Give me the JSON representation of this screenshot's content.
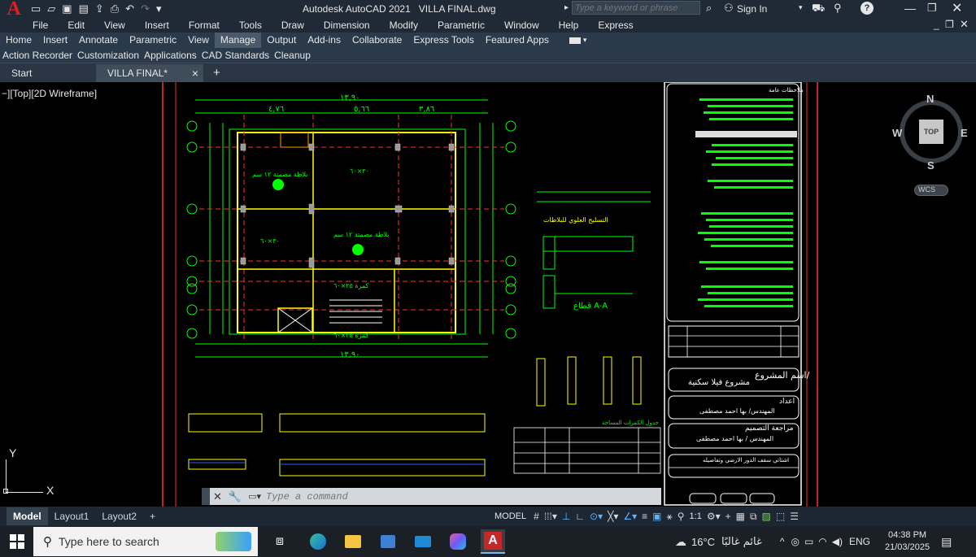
{
  "app": {
    "title": "Autodesk AutoCAD 2021",
    "filename": "VILLA FINAL.dwg",
    "search_placeholder": "Type a keyword or phrase",
    "sign_in": "Sign In",
    "logo_letter": "A",
    "quick_access_icons": [
      "new-icon",
      "open-icon",
      "save-icon",
      "saveas-icon",
      "web-mobile-icon",
      "print-icon",
      "undo-icon",
      "redo-icon",
      "dropdown-icon"
    ]
  },
  "menubar": [
    "File",
    "Edit",
    "View",
    "Insert",
    "Format",
    "Tools",
    "Draw",
    "Dimension",
    "Modify",
    "Parametric",
    "Window",
    "Help",
    "Express"
  ],
  "ribbon": {
    "tabs": [
      "Home",
      "Insert",
      "Annotate",
      "Parametric",
      "View",
      "Manage",
      "Output",
      "Add-ins",
      "Collaborate",
      "Express Tools",
      "Featured Apps"
    ],
    "active_tab": "Manage",
    "panels": [
      "Action Recorder",
      "Customization",
      "Applications",
      "CAD Standards",
      "Cleanup"
    ]
  },
  "file_tabs": {
    "start": "Start",
    "active": "VILLA FINAL*",
    "close": "×",
    "add": "+"
  },
  "viewport": {
    "label": "−][Top][2D Wireframe]",
    "compass": {
      "n": "N",
      "s": "S",
      "e": "E",
      "w": "W",
      "top": "TOP",
      "wcs": "WCS"
    },
    "ucs": {
      "x": "X",
      "y": "Y"
    },
    "command_placeholder": "Type a command",
    "drawing": {
      "top_dims": [
        "٤,٧٦",
        "٥,٦٦",
        "٣,٨٦"
      ],
      "top_total": "١٣,٩٠",
      "grid_labels_left": [
        "①",
        "②",
        "③",
        "④",
        "⑤",
        "⑥",
        "⑦",
        "⑧"
      ],
      "section_title": "قطاع A-A",
      "project_title_label": "اسم المشروع/",
      "project_name": "مشروع فيلا سكنية",
      "prepared_label": "اعداد",
      "engineer": "المهندس/ بها احمد مصطفى",
      "review_label": "مراجعة التصميم",
      "reviewer": "المهندس / بها احمد مصطفى",
      "sheet_label": "اشتاتي سقف الدور الارضي وتفاصيله",
      "schedule_title": "جدول الكمرات المساحة",
      "notes_title": "ملاحظات عامة"
    }
  },
  "layout_tabs": [
    "Model",
    "Layout1",
    "Layout2"
  ],
  "layout_add": "+",
  "status": {
    "model": "MODEL",
    "scale": "1:1"
  },
  "taskbar": {
    "search_placeholder": "Type here to search",
    "weather": "16°C",
    "weather_text": "غائم غالبًا",
    "lang": "ENG",
    "time": "04:38 PM",
    "date": "21/03/2025"
  },
  "colors": {
    "accent_red": "#d32f2f",
    "title_bg": "#1f2a36",
    "ribbon_bg": "#2b3a4a",
    "cad_green": "#00ff00",
    "cad_yellow": "#ffff00",
    "cad_red": "#ff3030"
  }
}
